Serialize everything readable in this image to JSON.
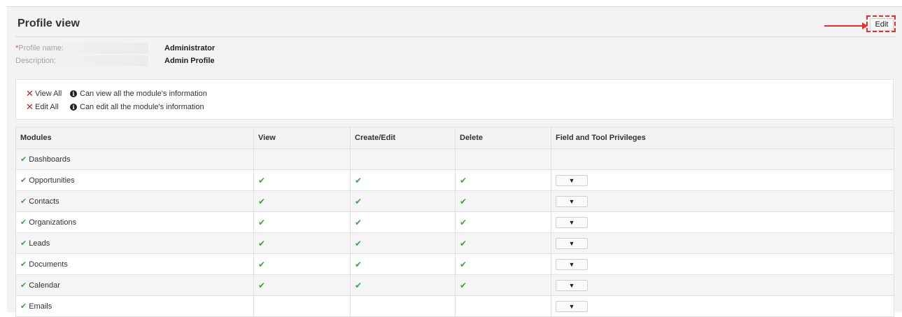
{
  "page": {
    "title": "Profile view",
    "edit_label": "Edit"
  },
  "fields": [
    {
      "label": "Profile name:",
      "required": true,
      "value": "Administrator"
    },
    {
      "label": "Description:",
      "required": false,
      "value": "Admin Profile"
    }
  ],
  "legend": [
    {
      "name": "View All",
      "desc": "Can view all the module's information"
    },
    {
      "name": "Edit All",
      "desc": "Can edit all the module's information"
    }
  ],
  "table": {
    "headers": [
      "Modules",
      "View",
      "Create/Edit",
      "Delete",
      "Field and Tool Privileges"
    ],
    "rows": [
      {
        "module": "Dashboards",
        "view": false,
        "create": false,
        "delete": false,
        "tools": false
      },
      {
        "module": "Opportunities",
        "view": true,
        "create": true,
        "delete": true,
        "tools": true
      },
      {
        "module": "Contacts",
        "view": true,
        "create": true,
        "delete": true,
        "tools": true
      },
      {
        "module": "Organizations",
        "view": true,
        "create": true,
        "delete": true,
        "tools": true
      },
      {
        "module": "Leads",
        "view": true,
        "create": true,
        "delete": true,
        "tools": true
      },
      {
        "module": "Documents",
        "view": true,
        "create": true,
        "delete": true,
        "tools": true
      },
      {
        "module": "Calendar",
        "view": true,
        "create": true,
        "delete": true,
        "tools": true
      },
      {
        "module": "Emails",
        "view": false,
        "create": false,
        "delete": false,
        "tools": true
      }
    ]
  },
  "icons": {
    "check": "check-icon",
    "cross": "cross-icon",
    "info": "info-icon",
    "dropdown": "chevron-down-icon"
  },
  "colors": {
    "check": "#3aa63a",
    "cross": "#c0281b",
    "annotation": "#e53030"
  }
}
